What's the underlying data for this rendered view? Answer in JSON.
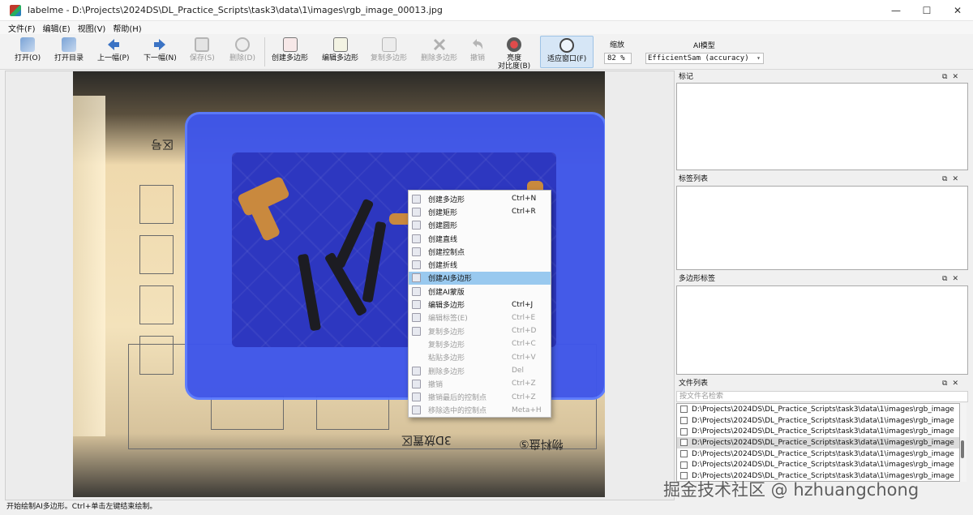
{
  "window": {
    "title": "labelme - D:\\Projects\\2024DS\\DL_Practice_Scripts\\task3\\data\\1\\images\\rgb_image_00013.jpg",
    "minimize": "—",
    "maximize": "☐",
    "close": "✕"
  },
  "menu": [
    "文件(F)",
    "编辑(E)",
    "视图(V)",
    "帮助(H)"
  ],
  "toolbar": {
    "open": "打开(O)",
    "open_dir": "打开目录",
    "prev": "上一幅(P)",
    "next": "下一幅(N)",
    "save": "保存(S)",
    "delete": "删除(D)",
    "create_polygon": "创建多边形",
    "edit_polygon": "编辑多边形",
    "copy_polygon": "复制多边形",
    "delete_polygon": "删除多边形",
    "undo": "撤销",
    "brightness_line1": "亮度",
    "brightness_line2": "对比度(B)",
    "fit_window": "适应窗口(F)",
    "zoom_label": "缩放",
    "zoom_value": "82 %",
    "ai_label": "AI模型",
    "ai_model": "EfficientSam (accuracy)"
  },
  "photo_text": {
    "top_label": "区号",
    "bottom_label_1": "3D放置区",
    "bottom_label_2": "物料盘⑤"
  },
  "context_menu": [
    {
      "label": "创建多边形",
      "shortcut": "Ctrl+N",
      "disabled": false
    },
    {
      "label": "创建矩形",
      "shortcut": "Ctrl+R",
      "disabled": false
    },
    {
      "label": "创建圆形",
      "shortcut": "",
      "disabled": false
    },
    {
      "label": "创建直线",
      "shortcut": "",
      "disabled": false
    },
    {
      "label": "创建控制点",
      "shortcut": "",
      "disabled": false
    },
    {
      "label": "创建折线",
      "shortcut": "",
      "disabled": false
    },
    {
      "label": "创建AI多边形",
      "shortcut": "",
      "disabled": false,
      "highlighted": true
    },
    {
      "label": "创建AI蒙版",
      "shortcut": "",
      "disabled": false
    },
    {
      "label": "编辑多边形",
      "shortcut": "Ctrl+J",
      "disabled": false
    },
    {
      "label": "编辑标签(E)",
      "shortcut": "Ctrl+E",
      "disabled": true
    },
    {
      "label": "复制多边形",
      "shortcut": "Ctrl+D",
      "disabled": true
    },
    {
      "label": "复制多边形",
      "shortcut": "Ctrl+C",
      "disabled": true
    },
    {
      "label": "粘贴多边形",
      "shortcut": "Ctrl+V",
      "disabled": true
    },
    {
      "label": "删除多边形",
      "shortcut": "Del",
      "disabled": true
    },
    {
      "label": "撤销",
      "shortcut": "Ctrl+Z",
      "disabled": true
    },
    {
      "label": "撤销最后的控制点",
      "shortcut": "Ctrl+Z",
      "disabled": true
    },
    {
      "label": "移除选中的控制点",
      "shortcut": "Meta+H",
      "disabled": true
    }
  ],
  "docks": {
    "labels_title": "标记",
    "label_list_title": "标签列表",
    "polygon_labels_title": "多边形标签",
    "file_list_title": "文件列表",
    "dock_controls": "⧉✕",
    "search_placeholder": "按文件名检索"
  },
  "files": [
    "D:\\Projects\\2024DS\\DL_Practice_Scripts\\task3\\data\\1\\images\\rgb_image",
    "D:\\Projects\\2024DS\\DL_Practice_Scripts\\task3\\data\\1\\images\\rgb_image",
    "D:\\Projects\\2024DS\\DL_Practice_Scripts\\task3\\data\\1\\images\\rgb_image",
    "D:\\Projects\\2024DS\\DL_Practice_Scripts\\task3\\data\\1\\images\\rgb_image",
    "D:\\Projects\\2024DS\\DL_Practice_Scripts\\task3\\data\\1\\images\\rgb_image",
    "D:\\Projects\\2024DS\\DL_Practice_Scripts\\task3\\data\\1\\images\\rgb_image",
    "D:\\Projects\\2024DS\\DL_Practice_Scripts\\task3\\data\\1\\images\\rgb_image"
  ],
  "selected_file_index": 3,
  "status": "开始绘制AI多边形。Ctrl+单击左键结束绘制。",
  "watermark": "掘金技术社区 @ hzhuangchong",
  "colors": {
    "accent_highlight": "#99c9ef",
    "tray_blue": "#3f56ea",
    "disabled_text": "#9b9b9b"
  }
}
